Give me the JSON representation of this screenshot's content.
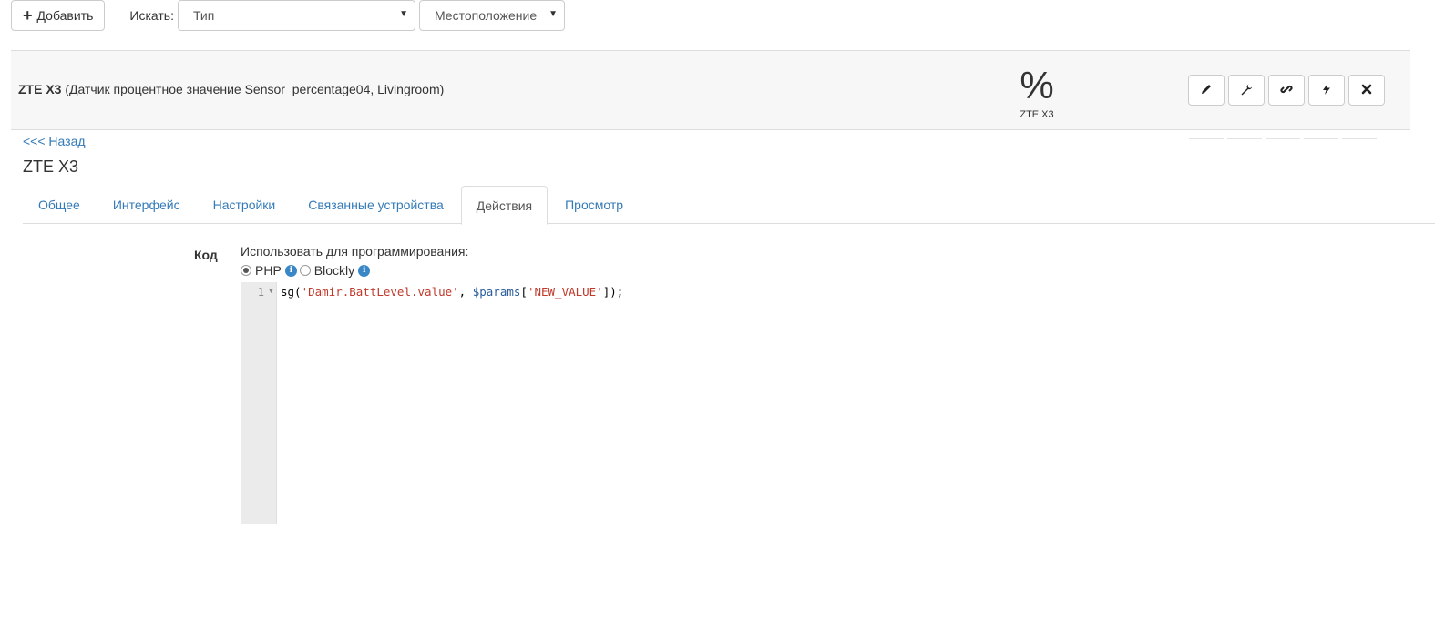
{
  "toolbar": {
    "add_label": "Добавить",
    "search_label": "Искать:",
    "type_select": "Тип",
    "location_select": "Местоположение"
  },
  "device": {
    "name": "ZTE X3",
    "description": "(Датчик процентное значение Sensor_percentage04, Livingroom)",
    "value_symbol": "%",
    "value_caption": "ZTE X3",
    "actions": [
      {
        "icon": "pencil-icon"
      },
      {
        "icon": "wrench-icon"
      },
      {
        "icon": "link-icon"
      },
      {
        "icon": "bolt-icon"
      },
      {
        "icon": "close-icon"
      }
    ]
  },
  "page": {
    "back_link": "<<< Назад",
    "title": "ZTE X3"
  },
  "tabs": [
    {
      "label": "Общее",
      "active": false
    },
    {
      "label": "Интерфейс",
      "active": false
    },
    {
      "label": "Настройки",
      "active": false
    },
    {
      "label": "Связанные устройства",
      "active": false
    },
    {
      "label": "Действия",
      "active": true
    },
    {
      "label": "Просмотр",
      "active": false
    }
  ],
  "form": {
    "code_label": "Код",
    "use_for_label": "Использовать для программирования:",
    "radio_options": [
      {
        "label": "PHP",
        "checked": true
      },
      {
        "label": "Blockly",
        "checked": false
      }
    ],
    "info_glyph": "i"
  },
  "editor": {
    "line_numbers": [
      "1"
    ],
    "code": {
      "fn_open": "sg(",
      "str1": "'Damir.BattLevel.value'",
      "comma": ", ",
      "var": "$params",
      "bracket_open": "[",
      "str2": "'NEW_VALUE'",
      "close": "]);"
    }
  },
  "colors": {
    "link": "#337ab7",
    "info_icon": "#3a87c8",
    "device_row_bg": "#f7f7f7",
    "string_token": "#c0392b",
    "variable_token": "#2a5c9a"
  }
}
